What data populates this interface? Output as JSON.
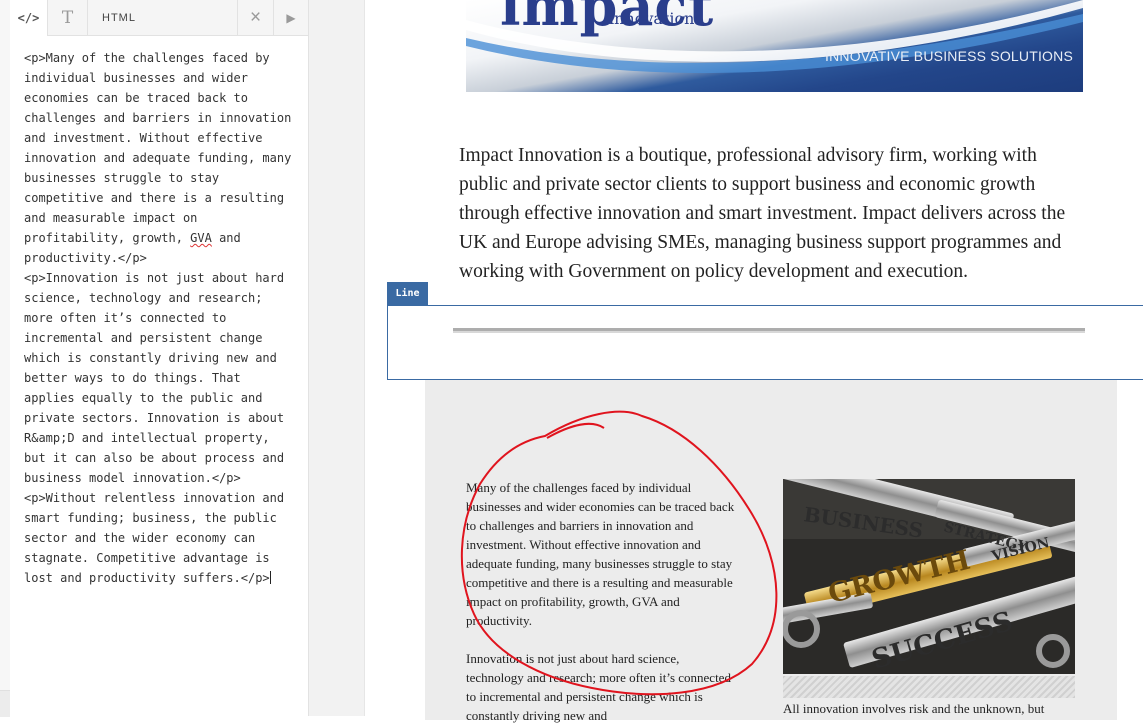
{
  "editor": {
    "toolbar": {
      "code_icon": "</>",
      "text_icon": "T",
      "mode_label": "HTML",
      "close_icon": "×",
      "run_icon": "▶"
    },
    "code_lines": [
      "<p>Many of the challenges faced by",
      "individual businesses and wider",
      "economies can be traced back to",
      "challenges and barriers in innovation",
      "and investment. Without effective",
      "innovation and adequate funding, many",
      "businesses struggle to stay",
      "competitive and there is a resulting",
      "and measurable impact on",
      "profitability, growth, ",
      "GVA",
      " and",
      "productivity.</p>",
      "<p>Innovation is not just about hard",
      "science, technology and research;",
      "more often it’s connected to",
      "incremental and persistent change",
      "which is constantly driving new and",
      "better ways to do things. That",
      "applies equally to the public and",
      "private sectors. Innovation is about",
      "R&amp;D and intellectual property,",
      "but it can also be about process and",
      "business model innovation.</p>",
      "<p>Without relentless innovation and",
      "smart funding; business, the public",
      "sector and the wider economy can",
      "stagnate. Competitive advantage is",
      "lost and productivity suffers.</p>"
    ]
  },
  "preview": {
    "banner": {
      "logo": "impact",
      "logo_sub": "innovation",
      "tagline": "INNOVATIVE BUSINESS SOLUTIONS"
    },
    "intro": "Impact Innovation is a boutique, professional advisory firm, working with public and private sector clients to support business and economic growth through effective innovation and smart investment. Impact delivers across the UK and Europe advising SMEs, managing business support programmes and working with Government on policy development and execution.",
    "line_block_label": "Line",
    "para_1": "Many of the challenges faced by individual businesses and wider economies can be traced back to challenges and barriers in innovation and investment. Without effective innovation and adequate funding, many businesses struggle to stay competitive and there is a resulting and measurable impact on profitability, growth, GVA and productivity.",
    "para_2": "Innovation is not just about hard science, technology and research; more often it’s connected to incremental and persistent change which is constantly driving new and",
    "para_3": "All innovation involves risk and the unknown, but",
    "image_words": [
      "BUSINESS",
      "STRATEGY",
      "VISION",
      "GROWTH",
      "SUCCESS"
    ]
  },
  "colors": {
    "accent_blue": "#3a6aa3",
    "annotation_red": "#e0141e",
    "section_bg": "#ececec"
  }
}
